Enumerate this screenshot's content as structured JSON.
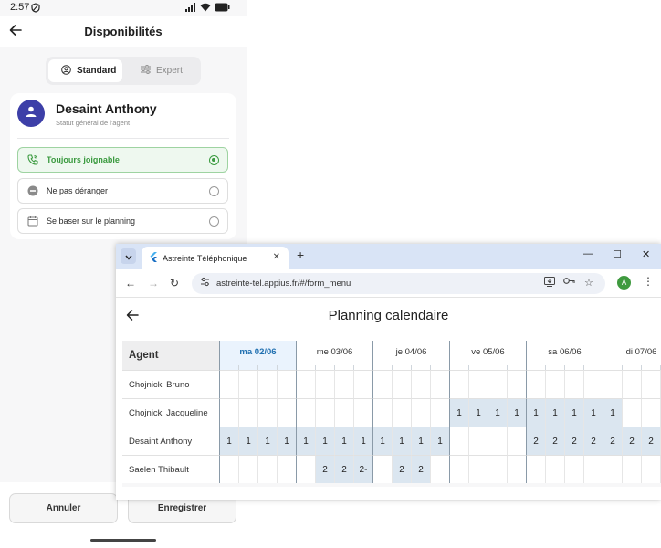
{
  "status_bar": {
    "time": "2:57"
  },
  "app": {
    "title": "Disponibilités",
    "segments": {
      "standard": "Standard",
      "expert": "Expert"
    },
    "agent": {
      "name": "Desaint Anthony",
      "subtitle": "Statut général de l'agent"
    },
    "options": [
      {
        "label": "Toujours joignable",
        "icon": "phone-icon",
        "selected": true
      },
      {
        "label": "Ne pas déranger",
        "icon": "do-not-disturb-icon",
        "selected": false
      },
      {
        "label": "Se baser sur le planning",
        "icon": "calendar-icon",
        "selected": false
      }
    ],
    "buttons": {
      "cancel": "Annuler",
      "save": "Enregistrer"
    },
    "colors": {
      "accent_green": "#3a9a3f",
      "avatar": "#3d3fa8"
    }
  },
  "browser": {
    "tab_title": "Astreinte Téléphonique",
    "url": "astreinte-tel.appius.fr/#/form_menu",
    "profile_initial": "A",
    "page": {
      "title": "Planning calendaire",
      "agent_header": "Agent",
      "days": [
        {
          "label": "ma 02/06",
          "today": true
        },
        {
          "label": "me 03/06",
          "today": false
        },
        {
          "label": "je 04/06",
          "today": false
        },
        {
          "label": "ve 05/06",
          "today": false
        },
        {
          "label": "sa 06/06",
          "today": false
        },
        {
          "label": "di 07/06",
          "today": false
        }
      ],
      "rows": [
        {
          "agent": "Chojnicki Bruno",
          "cells": [
            "",
            "",
            "",
            "",
            "",
            "",
            "",
            "",
            "",
            "",
            "",
            "",
            "",
            "",
            "",
            "",
            "",
            "",
            "",
            "",
            "",
            "",
            "",
            ""
          ]
        },
        {
          "agent": "Chojnicki Jacqueline",
          "cells": [
            "",
            "",
            "",
            "",
            "",
            "",
            "",
            "",
            "",
            "",
            "",
            "",
            "1",
            "1",
            "1",
            "1",
            "1",
            "1",
            "1",
            "1",
            "1",
            "",
            "",
            ""
          ]
        },
        {
          "agent": "Desaint Anthony",
          "cells": [
            "1",
            "1",
            "1",
            "1",
            "1",
            "1",
            "1",
            "1",
            "1",
            "1",
            "1",
            "1",
            "",
            "",
            "",
            "",
            "2",
            "2",
            "2",
            "2",
            "2",
            "2",
            "2",
            ""
          ]
        },
        {
          "agent": "Saelen Thibault",
          "cells": [
            "",
            "",
            "",
            "",
            "",
            "2",
            "2",
            "2-",
            "",
            "2",
            "2",
            "",
            "",
            "",
            "",
            "",
            "",
            "",
            "",
            "",
            "",
            "",
            "",
            ""
          ]
        }
      ]
    }
  }
}
